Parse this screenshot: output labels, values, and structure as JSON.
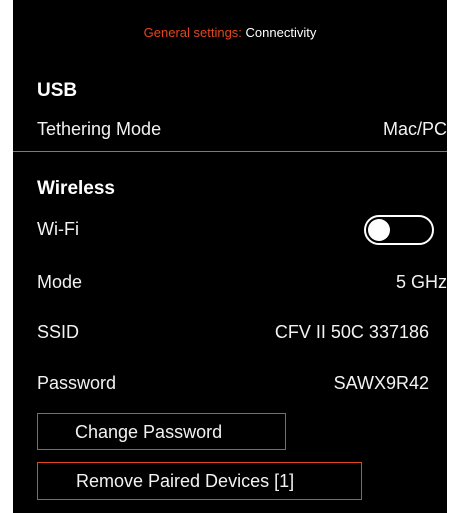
{
  "header": {
    "crumb": "General settings:",
    "title": "Connectivity"
  },
  "usb": {
    "title": "USB",
    "tethering_label": "Tethering Mode",
    "tethering_value": "Mac/PC"
  },
  "wireless": {
    "title": "Wireless",
    "wifi_label": "Wi-Fi",
    "wifi_enabled": false,
    "mode_label": "Mode",
    "mode_value": "5 GHz",
    "ssid_label": "SSID",
    "ssid_value": "CFV II 50C 337186",
    "password_label": "Password",
    "password_value": "SAWX9R42"
  },
  "actions": {
    "change_password": "Change Password",
    "remove_paired": "Remove Paired Devices [1]"
  },
  "colors": {
    "accent": "#e2451f",
    "background": "#000000",
    "text": "#ffffff"
  }
}
